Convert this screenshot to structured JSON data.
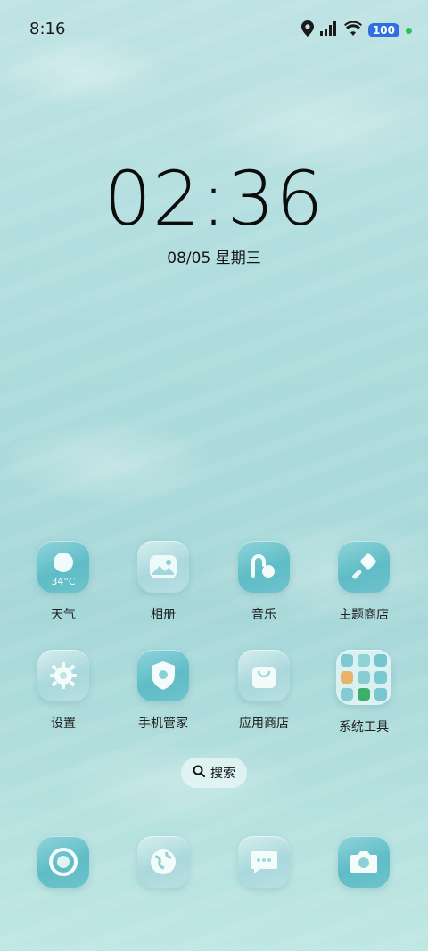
{
  "status": {
    "time": "8:16",
    "battery": "100",
    "icons": [
      "location-icon",
      "signal-icon",
      "wifi-icon"
    ]
  },
  "lockscreen": {
    "clock": "02:36",
    "date": "08/05 星期三"
  },
  "apps": [
    {
      "label": "天气",
      "icon": "weather-icon",
      "badge": "34°C"
    },
    {
      "label": "相册",
      "icon": "gallery-icon"
    },
    {
      "label": "音乐",
      "icon": "music-icon"
    },
    {
      "label": "主题商店",
      "icon": "theme-store-icon"
    },
    {
      "label": "设置",
      "icon": "settings-icon"
    },
    {
      "label": "手机管家",
      "icon": "phone-manager-icon"
    },
    {
      "label": "应用商店",
      "icon": "app-store-icon"
    },
    {
      "label": "系统工具",
      "icon": "folder-icon"
    }
  ],
  "search": {
    "label": "搜索"
  },
  "dock": [
    {
      "icon": "phone-dial-icon"
    },
    {
      "icon": "browser-icon"
    },
    {
      "icon": "messages-icon"
    },
    {
      "icon": "camera-icon"
    }
  ],
  "colors": {
    "accent": "#5fbcc6",
    "battery": "#2f6fe0",
    "active_dot": "#2dc153"
  }
}
